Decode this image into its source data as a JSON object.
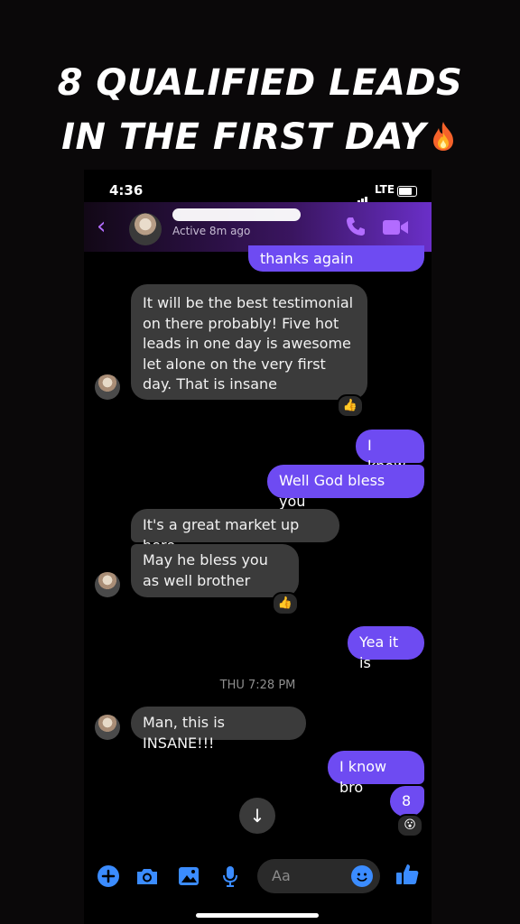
{
  "headline": {
    "line1": "8 QUALIFIED LEADS",
    "line2": "IN THE FIRST DAY"
  },
  "status_bar": {
    "time": "4:36",
    "network": "LTE"
  },
  "header": {
    "contact_name": "",
    "active_status": "Active 8m ago",
    "accent_color": "#b26cff"
  },
  "messages": [
    {
      "side": "out",
      "text": "thanks again"
    },
    {
      "side": "in",
      "text": "It will be the best testimonial on there probably! Five hot leads in one day is awesome let alone on the very first day. That is insane",
      "reaction": "👍"
    },
    {
      "side": "out",
      "text": "I know"
    },
    {
      "side": "out",
      "text": "Well God bless you"
    },
    {
      "side": "in",
      "text": "It's a great market up here"
    },
    {
      "side": "in",
      "text": "May he bless you as well brother",
      "reaction": "👍"
    },
    {
      "side": "out",
      "text": "Yea it is"
    },
    {
      "side": "in",
      "text": "Man, this is INSANE!!!"
    },
    {
      "side": "out",
      "text": "I know bro"
    },
    {
      "side": "out",
      "text": "8",
      "reaction": "😮"
    }
  ],
  "timestamp": "THU 7:28 PM",
  "composer": {
    "placeholder": "Aa"
  },
  "colors": {
    "outgoing_bubble": "#6e4bf2",
    "incoming_bubble": "#3b3b3b",
    "icon_blue": "#3b8cff"
  },
  "icons": [
    "fire-icon",
    "back-chevron-icon",
    "phone-icon",
    "video-icon",
    "scroll-down-arrow-icon",
    "plus-icon",
    "camera-icon",
    "gallery-icon",
    "microphone-icon",
    "emoji-icon",
    "thumbs-up-icon"
  ]
}
